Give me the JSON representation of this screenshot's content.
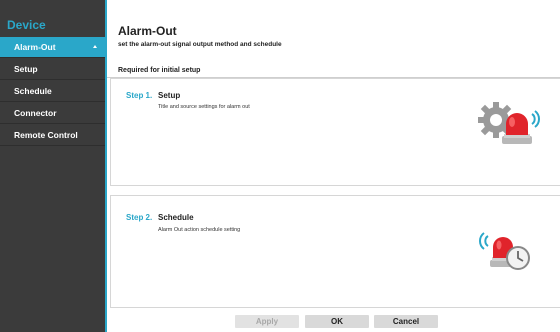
{
  "sidebar": {
    "title": "Device",
    "items": [
      {
        "label": "Alarm-Out"
      },
      {
        "label": "Setup"
      },
      {
        "label": "Schedule"
      },
      {
        "label": "Connector"
      },
      {
        "label": "Remote Control"
      }
    ]
  },
  "header": {
    "title": "Alarm-Out",
    "subtitle": "set the alarm-out signal output method and schedule"
  },
  "section": {
    "label": "Required for initial setup"
  },
  "steps": [
    {
      "number": "Step 1.",
      "title": "Setup",
      "description": "Title and source settings for alarm out",
      "icon": "gear-alarm-icon"
    },
    {
      "number": "Step 2.",
      "title": "Schedule",
      "description": "Alarm Out action schedule setting",
      "icon": "alarm-clock-icon"
    }
  ],
  "buttons": {
    "apply": "Apply",
    "ok": "OK",
    "cancel": "Cancel"
  },
  "colors": {
    "accent": "#2aa7c9",
    "sidebar_bg": "#3b3b3b",
    "alarm_red": "#e0242b"
  }
}
